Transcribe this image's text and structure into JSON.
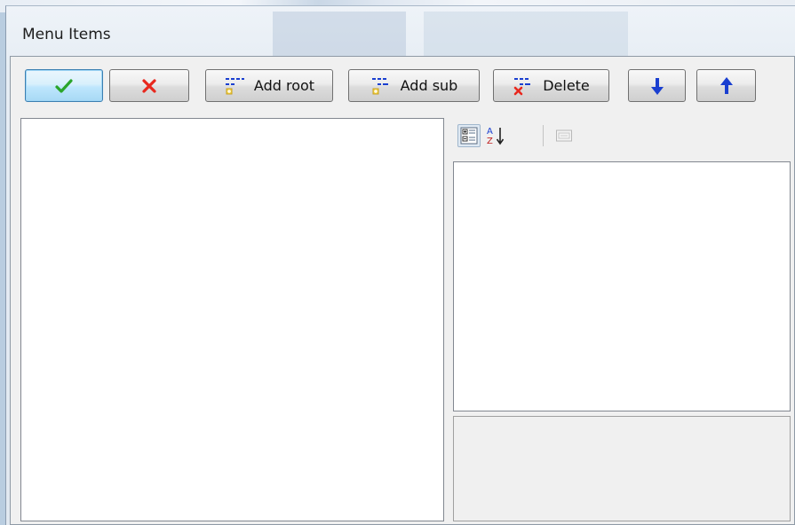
{
  "window": {
    "title": "Menu Items"
  },
  "toolbar": {
    "ok": {
      "icon": "checkmark-icon",
      "color": "#2aa52a"
    },
    "cancel": {
      "icon": "x-mark-icon",
      "color": "#e8281e"
    },
    "add_root": {
      "label": "Add root",
      "icon": "add-root-icon"
    },
    "add_sub": {
      "label": "Add sub",
      "icon": "add-sub-icon"
    },
    "delete": {
      "label": "Delete",
      "icon": "delete-item-icon"
    },
    "move_down": {
      "icon": "arrow-down-icon",
      "color": "#1a3fd0"
    },
    "move_up": {
      "icon": "arrow-up-icon",
      "color": "#1a3fd0"
    }
  },
  "property_grid": {
    "toolbar": {
      "categorized": {
        "icon": "categorized-icon",
        "active": true
      },
      "alphabetical": {
        "icon": "sort-alphabetical-icon",
        "active": false
      },
      "property_pages": {
        "icon": "property-pages-icon",
        "enabled": false
      }
    }
  },
  "colors": {
    "accent": "#3c7fb1",
    "panel_bg": "#f0f0f0"
  }
}
